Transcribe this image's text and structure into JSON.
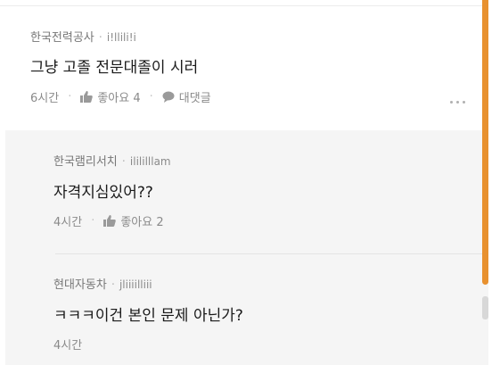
{
  "comments": [
    {
      "author": "한국전력공사",
      "nickname": "i!llili!i",
      "text": "그냥 고졸 전문대졸이 시러",
      "time": "6시간",
      "like_label": "좋아요 4",
      "reply_label": "대댓글"
    }
  ],
  "replies": [
    {
      "author": "한국램리서치",
      "nickname": "ilililllam",
      "text": "자격지심있어??",
      "time": "4시간",
      "like_label": "좋아요 2"
    },
    {
      "author": "현대자동차",
      "nickname": "jliiiilliii",
      "text": "ㅋㅋㅋ이건 본인 문제 아닌가?",
      "time": "4시간"
    }
  ],
  "colors": {
    "scrollbar_accent": "#e8912f",
    "reply_background": "#f5f5f5",
    "meta_text": "#777777"
  },
  "icons": {
    "like": "thumbs-up-icon",
    "reply": "speech-bubble-icon",
    "more": "more-dots-icon"
  }
}
